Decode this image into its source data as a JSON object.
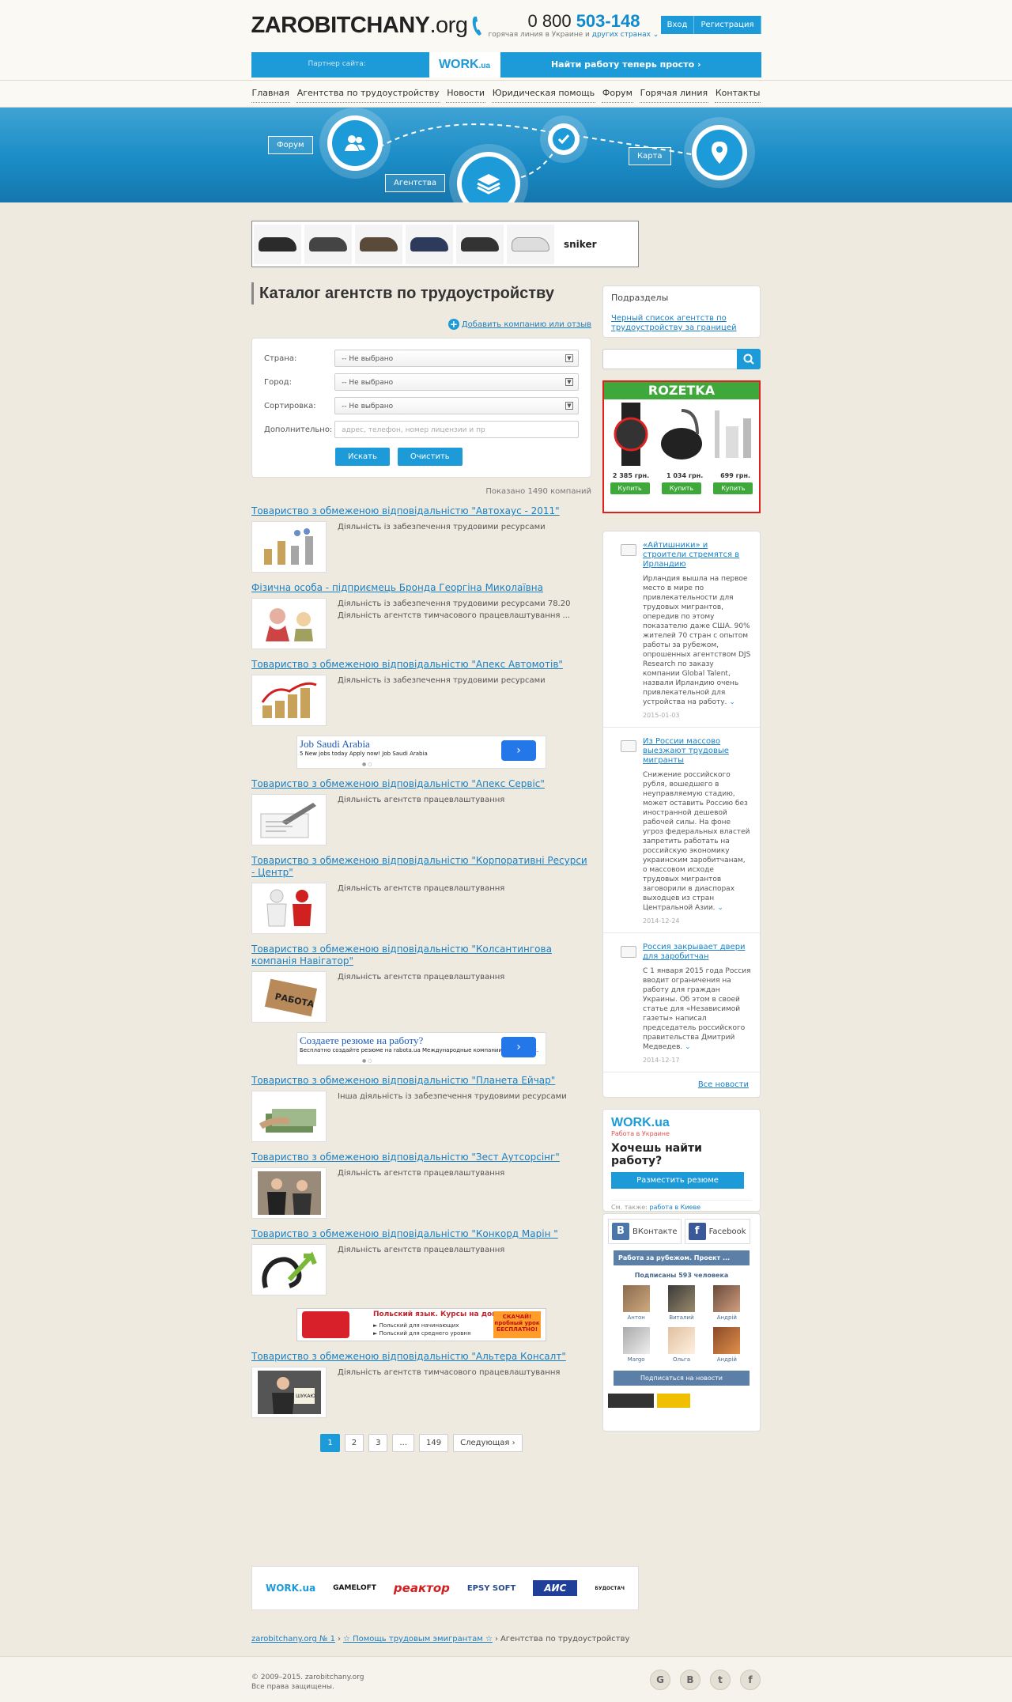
{
  "header": {
    "logo_main": "ZAROBITCHANY",
    "logo_tld": ".org",
    "phone_prefix": "0 800",
    "phone_number": "503-148",
    "phone_sub": "горячая линия в Украине и",
    "phone_sub_link": "других странах",
    "login": "Вход",
    "register": "Регистрация"
  },
  "partner": {
    "label": "Партнер сайта:",
    "brand": "WORK",
    "brand_tld": ".ua",
    "cta": "Найти работу теперь просто ›"
  },
  "nav": [
    "Главная",
    "Агентства по трудоустройству",
    "Новости",
    "Юридическая помощь",
    "Форум",
    "Горячая линия",
    "Контакты"
  ],
  "banner": {
    "forum": "Форум",
    "agencies": "Агентства",
    "map": "Карта"
  },
  "top_ad": {
    "brand": "sniker"
  },
  "main": {
    "title": "Каталог агентств по трудоустройству",
    "add_company": "Добавить компанию или отзыв",
    "filters": {
      "country_label": "Страна:",
      "city_label": "Город:",
      "sort_label": "Сортировка:",
      "extra_label": "Дополнительно:",
      "country_value": "-- Не выбрано",
      "city_value": "-- Не выбрано",
      "sort_value": "-- Не выбрано",
      "extra_placeholder": "адрес, телефон, номер лицензии и пр",
      "search_btn": "Искать",
      "clear_btn": "Очистить"
    },
    "shown": "Показано 1490 компаний",
    "companies": [
      {
        "title": "Товариство з обмеженою відповідальністю \"Автохаус - 2011\"",
        "desc1": "Діяльність із забезпечення трудовими ресурсами",
        "desc2": ""
      },
      {
        "title": "Фізична особа - підприємець Бронда Георгіна Миколаївна",
        "desc1": "Діяльність із забезпечення трудовими ресурсами 78.20",
        "desc2": "Діяльність агентств тимчасового працевлаштування ..."
      },
      {
        "title": "Товариство з обмеженою відповідальністю \"Апекс Автомотів\"",
        "desc1": "Діяльність із забезпечення трудовими ресурсами",
        "desc2": ""
      },
      {
        "title": "Товариство з обмеженою відповідальністю \"Апекс Сервіс\"",
        "desc1": "Діяльність агентств працевлаштування",
        "desc2": ""
      },
      {
        "title": "Товариство з обмеженою відповідальністю \"Корпоративні Ресурси - Центр\"",
        "desc1": "Діяльність агентств працевлаштування",
        "desc2": ""
      },
      {
        "title": "Товариство з обмеженою відповідальністю \"Колсантингова компанія Навігатор\"",
        "desc1": "Діяльність агентств працевлаштування",
        "desc2": ""
      },
      {
        "title": "Товариство з обмеженою відповідальністю \"Планета Ейчар\"",
        "desc1": "Інша діяльність із забезпечення трудовими ресурсами",
        "desc2": ""
      },
      {
        "title": "Товариство з обмеженою відповідальністю \"Зест Аутсорсінг\"",
        "desc1": "Діяльність агентств працевлаштування",
        "desc2": ""
      },
      {
        "title": "Товариство з обмеженою відповідальністю \"Конкорд Марін \"",
        "desc1": "Діяльність агентств працевлаштування",
        "desc2": ""
      },
      {
        "title": "Товариство з обмеженою відповідальністю \"Альтера Консалт\"",
        "desc1": "Діяльність агентств тимчасового працевлаштування",
        "desc2": ""
      }
    ],
    "ad1": {
      "title": "Job Saudi Arabia",
      "text": "5 New jobs today Apply now! Job Saudi Arabia"
    },
    "ad2": {
      "title": "Создаете резюме на работу?",
      "text": "Бесплатно создайте резюме на rabota.ua Международные компании найдут Вас."
    },
    "ad3": {
      "title": "Польский язык. Курсы на дому",
      "line1": "► Польский для начинающих",
      "line2": "► Польский для среднего уровня",
      "badge": "СКАЧАЙ! пробный урок БЕСПЛАТНО!"
    },
    "pager": [
      "1",
      "2",
      "3",
      "...",
      "149",
      "Следующая ›"
    ]
  },
  "sidebar": {
    "sections_title": "Подразделы",
    "sections_link": "Черный список агентств по трудоустройству за границей",
    "rozetka": {
      "brand": "ROZETKA",
      "prices": [
        "2 385 грн.",
        "1 034 грн.",
        "699 грн."
      ],
      "buy": "Купить"
    },
    "news": [
      {
        "title": "«Айтишники» и строители стремятся в Ирландию",
        "text": "Ирландия вышла на первое место в мире по привлекательности для трудовых мигрантов, опередив по этому показателю даже США. 90% жителей 70 стран с опытом работы за рубежом, опрошенных агентством DJS Research по заказу компании Global Talent, назвали Ирландию очень привлекательной для устройства на работу.",
        "date": "2015-01-03"
      },
      {
        "title": "Из России массово выезжают трудовые мигранты",
        "text": "Снижение российского рубля, вошедшего в неуправляемую стадию, может оставить Россию без иностранной дешевой рабочей силы. На фоне угроз федеральных властей запретить работать на российскую экономику украинским заробитчанам, о массовом исходе трудовых мигрантов заговорили в диаспорах выходцев из стран Центральной Азии.",
        "date": "2014-12-24"
      },
      {
        "title": "Россия закрывает двери для заробитчан",
        "text": "С 1 января 2015 года Россия вводит ограничения на работу для граждан Украины. Об этом в своей статье для «Независимой газеты» написал председатель российского правительства Дмитрий Медведев.",
        "date": "2014-12-17"
      }
    ],
    "all_news": "Все новости",
    "work": {
      "brand": "WORK.ua",
      "sub": "Работа в Украине",
      "question": "Хочешь найти работу?",
      "btn": "Разместить резюме",
      "footer_text": "См. также:",
      "footer_link": "работа в Киеве"
    },
    "social": {
      "vk": "ВКонтакте",
      "fb": "Facebook",
      "group": "Работа за рубежом. Проект ...",
      "subscribers": "Подписаны 593 человека",
      "faces": [
        "Антон",
        "Виталий",
        "Андрій",
        "Margo",
        "Ольга",
        "Андрій"
      ],
      "subscribe": "Подписаться на новости"
    }
  },
  "partners": [
    "WORK.ua",
    "GAMELOFT",
    "реактор",
    "EPSY SOFT",
    "АИС",
    "БУДОСТАЧ"
  ],
  "breadcrumb": {
    "home": "zarobitchany.org № 1",
    "section": "☆ Помощь трудовым эмигрантам ☆",
    "current": "Агентства по трудоустройству"
  },
  "footer": {
    "copyright": "© 2009–2015. zarobitchany.org",
    "rights": "Все права защищены."
  },
  "colors": {
    "accent": "#1d9ad8",
    "link": "#1a80c4",
    "background": "#efeadf"
  }
}
